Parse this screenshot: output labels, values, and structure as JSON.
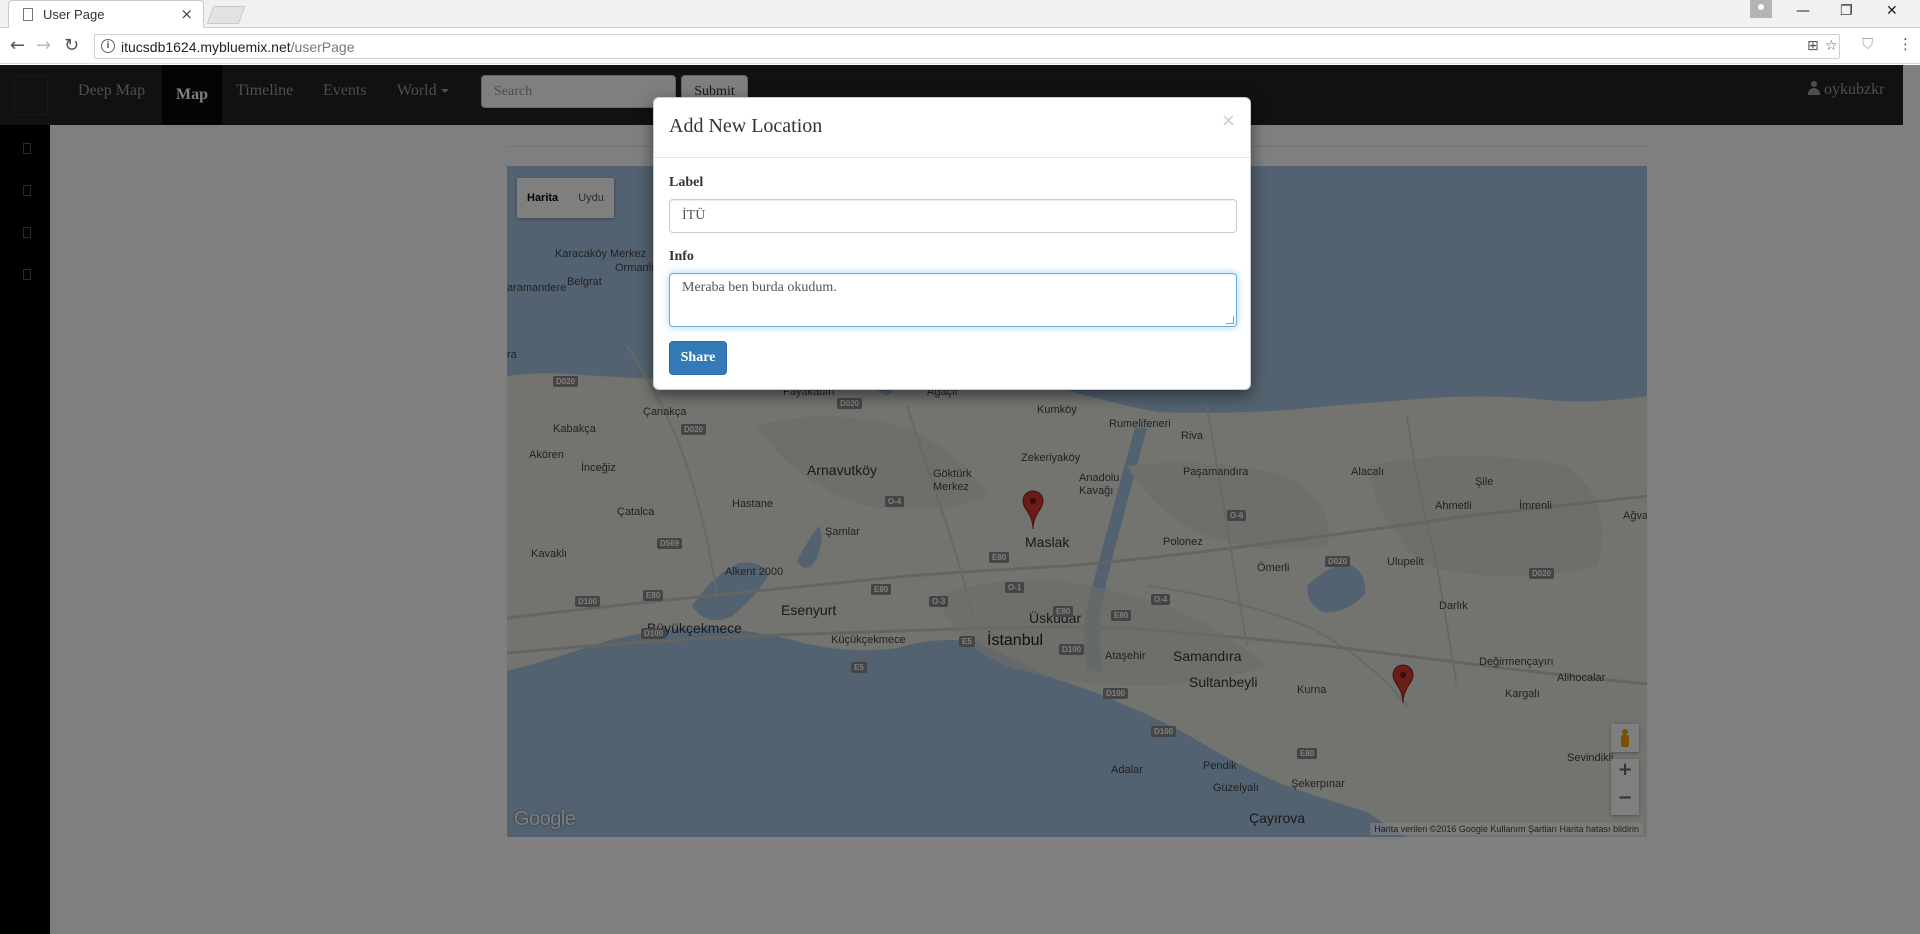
{
  "browser": {
    "tab_title": "User Page",
    "tab_close": "×",
    "url_host": "itucsdb1624.mybluemix.net",
    "url_path": "/userPage",
    "info_glyph": "i"
  },
  "navbar": {
    "links": [
      "Deep Map",
      "Map",
      "Timeline",
      "Events",
      "World"
    ],
    "active": "Map",
    "search_placeholder": "Search",
    "submit_label": "Submit",
    "user_name": "oykubzkr"
  },
  "map": {
    "type_buttons": [
      "Harita",
      "Uydu"
    ],
    "selected_type": "Harita",
    "google_logo": "Google",
    "attribution": "Harita verileri ©2016 Google    Kullanım Şartları    Harita hatası bildirin",
    "zoom_in": "+",
    "zoom_out": "−",
    "place_labels": [
      "Karacaköy Merkez",
      "Belgrat",
      "Ormanlı",
      "aramandere",
      "ra",
      "Çanakça",
      "Kabakça",
      "Akören",
      "İnceğiz",
      "Çatalca",
      "Kavaklı",
      "Hastane",
      "Arnavutköy",
      "Göktürk Merkez",
      "Şamlar",
      "Zekeriyaköy",
      "Kumköy",
      "Rumelifeneri",
      "Riva",
      "Paşamandıra",
      "Alacalı",
      "Şile",
      "Ahmetli",
      "İmrenli",
      "Ağva",
      "Anadolu Kavağı",
      "Maslak",
      "Polonez",
      "Ömerli",
      "Ulupelit",
      "Darlık",
      "Alkent 2000",
      "Esenyurt",
      "Büyükçekmece",
      "Küçükçekmece",
      "İstanbul",
      "Üsküdar",
      "Ataşehir",
      "Samandıra",
      "Sultanbeyli",
      "Kurna",
      "Değirmençayırı",
      "Kargalı",
      "Alihocalar",
      "Sevindikli",
      "Pendik",
      "Güzelyalı",
      "Şekerpınar",
      "Adalar",
      "Çayırova",
      "Ağaçlı",
      "Fayakadın"
    ],
    "road_shields": [
      "D020",
      "D020",
      "D020",
      "D569",
      "D100",
      "D100",
      "E80",
      "E80",
      "E80",
      "E80",
      "E80",
      "O-4",
      "O-3",
      "O-1",
      "O-6",
      "O-4",
      "D020",
      "D020",
      "D100",
      "D100",
      "D100",
      "E5",
      "E5",
      "E80"
    ]
  },
  "modal": {
    "title": "Add New Location",
    "close": "×",
    "label_caption": "Label",
    "label_value": "İTÜ",
    "info_caption": "Info",
    "info_value": "Meraba ben burda okudum.",
    "share_label": "Share"
  },
  "colors": {
    "navbar": "#222222",
    "primary_button": "#337ab7",
    "marker": "#d03a33"
  }
}
